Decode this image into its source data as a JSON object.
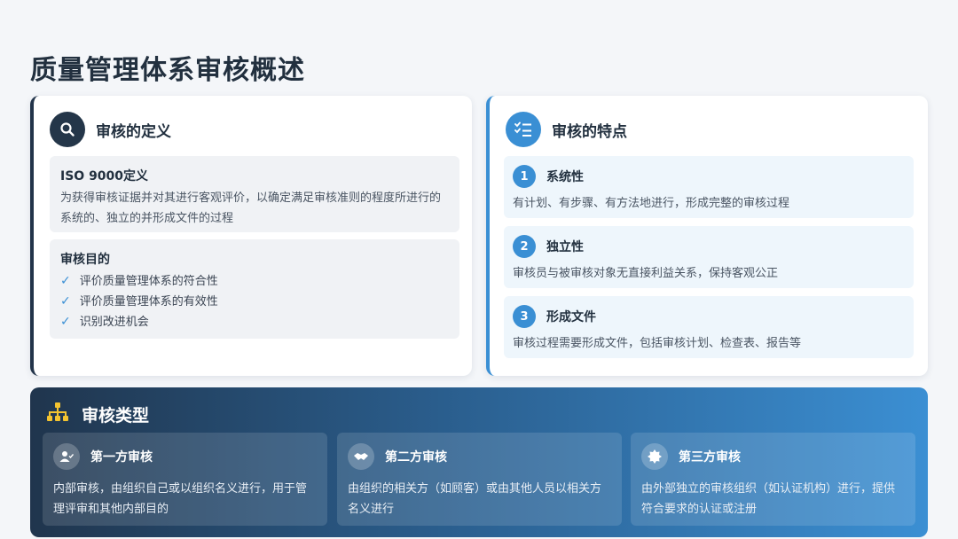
{
  "page": {
    "title": "质量管理体系审核概述"
  },
  "definition_card": {
    "title": "审核的定义",
    "iso_title": "ISO 9000定义",
    "iso_text": "为获得审核证据并对其进行客观评价，以确定满足审核准则的程度所进行的系统的、独立的并形成文件的过程",
    "purpose_title": "审核目的",
    "purposes": [
      "评价质量管理体系的符合性",
      "评价质量管理体系的有效性",
      "识别改进机会"
    ]
  },
  "features_card": {
    "title": "审核的特点",
    "items": [
      {
        "num": "1",
        "title": "系统性",
        "text": "有计划、有步骤、有方法地进行，形成完整的审核过程"
      },
      {
        "num": "2",
        "title": "独立性",
        "text": "审核员与被审核对象无直接利益关系，保持客观公正"
      },
      {
        "num": "3",
        "title": "形成文件",
        "text": "审核过程需要形成文件，包括审核计划、检查表、报告等"
      }
    ]
  },
  "types": {
    "title": "审核类型",
    "items": [
      {
        "title": "第一方审核",
        "text": "内部审核，由组织自己或以组织名义进行，用于管理评审和其他内部目的",
        "icon": "user-check-icon"
      },
      {
        "title": "第二方审核",
        "text": "由组织的相关方（如顾客）或由其他人员以相关方名义进行",
        "icon": "handshake-icon"
      },
      {
        "title": "第三方审核",
        "text": "由外部独立的审核组织（如认证机构）进行，提供符合要求的认证或注册",
        "icon": "certificate-icon"
      }
    ]
  },
  "colors": {
    "dark_navy": "#243649",
    "accent_blue": "#3a8fd4",
    "icon_yellow": "#f4c430"
  }
}
